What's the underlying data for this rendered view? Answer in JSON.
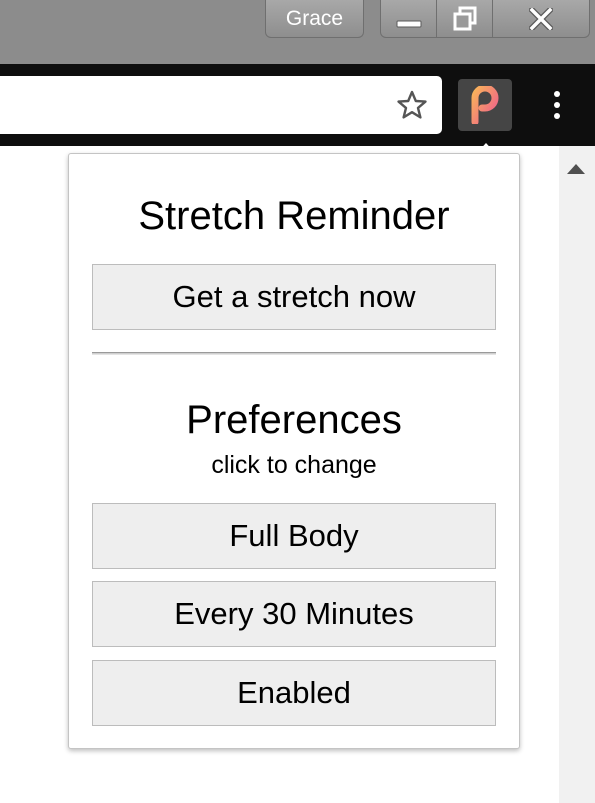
{
  "window": {
    "profile_name": "Grace",
    "minimize_icon": "minimize-icon",
    "restore_icon": "restore-icon",
    "close_icon": "close-icon"
  },
  "toolbar": {
    "bookmark_icon": "star-icon",
    "extension_icon": "p-logo-icon",
    "menu_icon": "vertical-dots-icon"
  },
  "popup": {
    "title": "Stretch Reminder",
    "stretch_now_label": "Get a stretch now",
    "preferences_title": "Preferences",
    "preferences_subtitle": "click to change",
    "body_area_value": "Full Body",
    "frequency_value": "Every 30 Minutes",
    "status_value": "Enabled"
  },
  "colors": {
    "titlebar": "#8c8c8c",
    "toolbar": "#0e0e0e",
    "button_bg": "#eeeeee",
    "button_border": "#bcbcbc",
    "logo_gradient_start": "#f7a35c",
    "logo_gradient_end": "#ee5a8e"
  }
}
